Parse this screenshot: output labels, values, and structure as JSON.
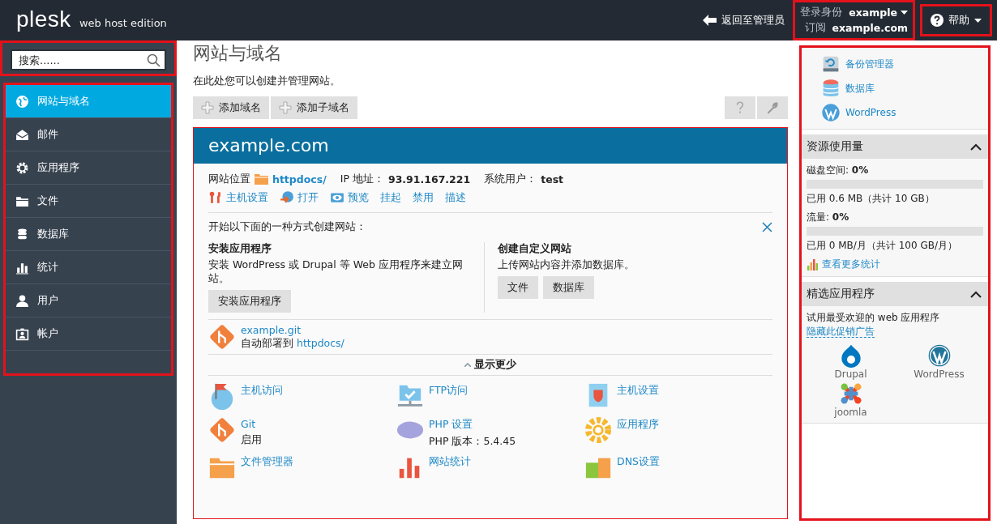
{
  "header": {
    "logo": "plesk",
    "edition": "web host edition",
    "back_link": "返回至管理员",
    "login": {
      "highlighted": true,
      "label": "登录身份",
      "user": "example",
      "sub_label": "订阅",
      "subscription": "example.com"
    },
    "help": {
      "highlighted": true,
      "label": "帮助"
    }
  },
  "sidebar": {
    "search": {
      "highlighted": true,
      "placeholder": "搜索......"
    },
    "nav": {
      "highlighted": true,
      "items": [
        {
          "label": "网站与域名",
          "selected": true
        },
        {
          "label": "邮件",
          "selected": false
        },
        {
          "label": "应用程序",
          "selected": false
        },
        {
          "label": "文件",
          "selected": false
        },
        {
          "label": "数据库",
          "selected": false
        },
        {
          "label": "统计",
          "selected": false
        },
        {
          "label": "用户",
          "selected": false
        },
        {
          "label": "帐户",
          "selected": false
        }
      ]
    }
  },
  "main": {
    "title": "网站与域名",
    "description": "在此处您可以创建并管理网站。",
    "toolbar": [
      "添加域名",
      "添加子域名"
    ],
    "site": {
      "highlighted": true,
      "domain": "example.com",
      "location_label": "网站位置",
      "location": "httpdocs/",
      "ip_label": "IP 地址：",
      "ip": "93.91.167.221",
      "user_label": "系统用户：",
      "user": "test",
      "actions": [
        "主机设置",
        "打开",
        "预览",
        "挂起",
        "禁用",
        "描述"
      ],
      "create": {
        "title": "开始以下面的一种方式创建网站：",
        "columns": [
          {
            "heading": "安装应用程序",
            "text": "安装 WordPress 或 Drupal 等 Web 应用程序来建立网站。",
            "buttons": [
              "安装应用程序"
            ]
          },
          {
            "heading": "创建自定义网站",
            "text": "上传网站内容并添加数据库。",
            "buttons": [
              "文件",
              "数据库"
            ]
          }
        ]
      },
      "git": {
        "repo": "example.git",
        "deploy_label": "自动部署到",
        "deploy_target": "httpdocs/"
      },
      "toggle": "显示更少",
      "tools": [
        {
          "label": "主机访问"
        },
        {
          "label": "FTP访问"
        },
        {
          "label": "主机设置"
        },
        {
          "label": "Git",
          "detail": "启用"
        },
        {
          "label": "PHP 设置",
          "detail": "PHP 版本：5.4.45"
        },
        {
          "label": "应用程序"
        },
        {
          "label": "文件管理器"
        },
        {
          "label": "网站统计"
        },
        {
          "label": "DNS设置"
        }
      ]
    }
  },
  "right": {
    "highlighted": true,
    "links": [
      "备份管理器",
      "数据库",
      "WordPress"
    ],
    "resources": {
      "title": "资源使用量",
      "expanded": true,
      "meters": [
        {
          "label": "磁盘空间: ",
          "value": "0%",
          "level": 0,
          "usage": "已用 0.6 MB（共计 10 GB）"
        },
        {
          "label": "流量: ",
          "value": "0%",
          "level": 0,
          "usage": "已用 0 MB/月（共计 100 GB/月）"
        }
      ],
      "more_link": "查看更多统计"
    },
    "featured": {
      "title": "精选应用程序",
      "expanded": true,
      "text": "试用最受欢迎的 web 应用程序 ",
      "hide_link": "隐藏此促销广告",
      "apps": [
        "Drupal",
        "WordPress",
        "joomla"
      ]
    }
  }
}
